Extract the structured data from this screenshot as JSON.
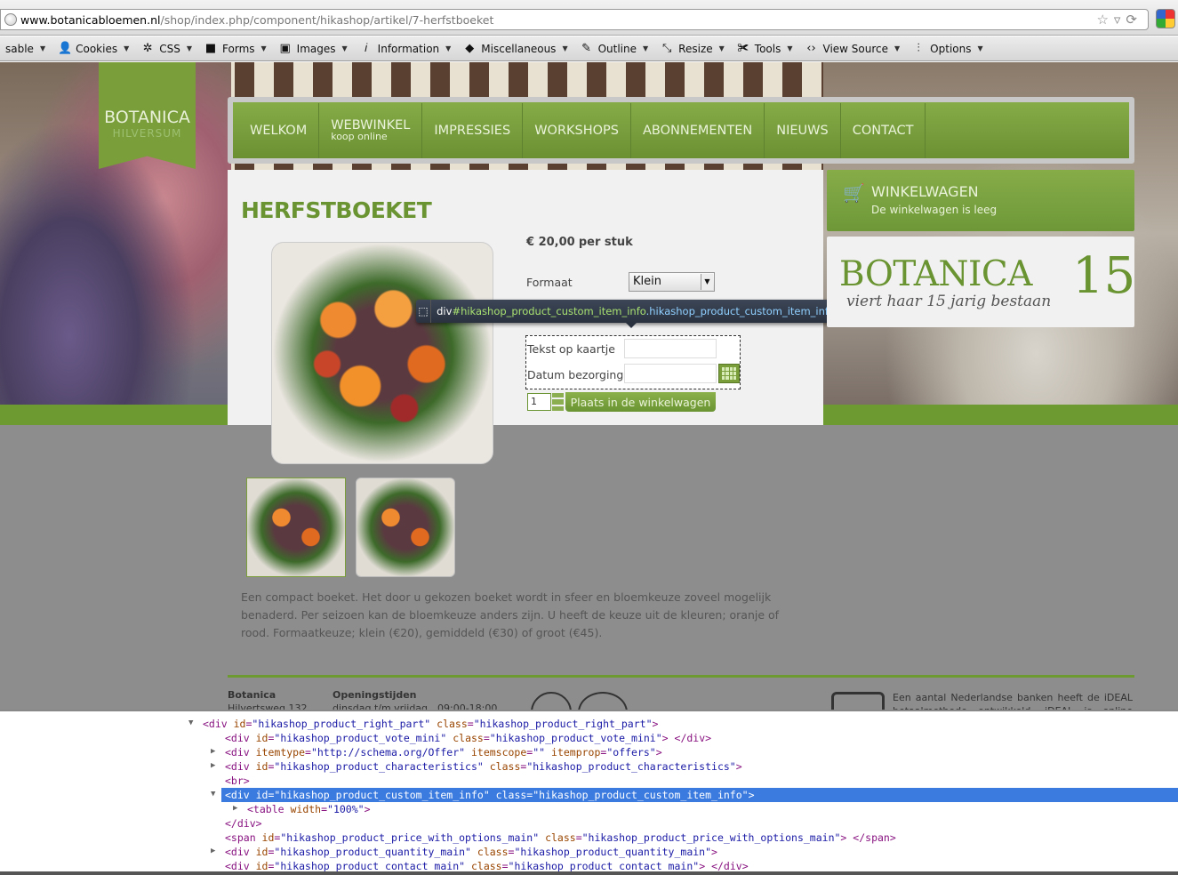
{
  "browser": {
    "url_host": "www.botanicabloemen.nl",
    "url_path": "/shop/index.php/component/hikashop/artikel/7-herfstboeket"
  },
  "toolbar": {
    "items": [
      {
        "label": "sable",
        "icon": "partial"
      },
      {
        "label": "Cookies",
        "icon": "user-icon"
      },
      {
        "label": "CSS",
        "icon": "wand-icon"
      },
      {
        "label": "Forms",
        "icon": "briefcase-icon"
      },
      {
        "label": "Images",
        "icon": "image-icon"
      },
      {
        "label": "Information",
        "icon": "info-icon"
      },
      {
        "label": "Miscellaneous",
        "icon": "cube-icon"
      },
      {
        "label": "Outline",
        "icon": "pencil-icon"
      },
      {
        "label": "Resize",
        "icon": "resize-icon"
      },
      {
        "label": "Tools",
        "icon": "wrench-icon"
      },
      {
        "label": "View Source",
        "icon": "code-icon"
      },
      {
        "label": "Options",
        "icon": "sliders-icon"
      }
    ]
  },
  "site": {
    "logo": {
      "name": "BOTANICA",
      "city": "HILVERSUM"
    },
    "nav": [
      {
        "label": "WELKOM",
        "sub": ""
      },
      {
        "label": "WEBWINKEL",
        "sub": "koop online"
      },
      {
        "label": "IMPRESSIES",
        "sub": ""
      },
      {
        "label": "WORKSHOPS",
        "sub": ""
      },
      {
        "label": "ABONNEMENTEN",
        "sub": ""
      },
      {
        "label": "NIEUWS",
        "sub": ""
      },
      {
        "label": "CONTACT",
        "sub": ""
      }
    ],
    "product": {
      "title": "HERFSTBOEKET",
      "price": "€ 20,00",
      "price_unit": "per stuk",
      "format_label": "Formaat",
      "format_value": "Klein",
      "card_text_label": "Tekst op kaartje",
      "delivery_date_label": "Datum bezorging",
      "quantity": "1",
      "cart_button": "Plaats in de winkelwagen",
      "description": "Een compact boeket. Het door u gekozen boeket wordt in sfeer en bloemkeuze zoveel mogelijk benaderd. Per seizoen kan de bloemkeuze anders zijn. U heeft de keuze uit de kleuren; oranje of rood. Formaatkeuze; klein (€20), gemiddeld (€30) of groot (€45)."
    },
    "cart": {
      "title": "WINKELWAGEN",
      "status": "De winkelwagen is leeg"
    },
    "promo": {
      "brand": "BOTANICA",
      "number": "15",
      "tagline": "viert haar 15 jarig bestaan"
    },
    "footer": {
      "name": "Botanica",
      "address": "Hilvertsweg 132",
      "hours_title": "Openingstijden",
      "days": "dinsdag t/m vrijdag",
      "time": "09:00-18:00",
      "ideal_text": "Een aantal Nederlandse banken heeft de iDEAL betaalmethode ontwikkeld. iDEAL is online betalen via"
    }
  },
  "inspector": {
    "tag": "div",
    "id": "#hikashop_product_custom_item_info",
    "cls": ".hikashop_product_custom_item_info"
  },
  "devtools": {
    "lines": [
      {
        "indent": 0,
        "tri": "down",
        "html": "<div id=\"hikashop_product_right_part\" class=\"hikashop_product_right_part\">"
      },
      {
        "indent": 1,
        "tri": "",
        "html": "<div id=\"hikashop_product_vote_mini\" class=\"hikashop_product_vote_mini\"> </div>"
      },
      {
        "indent": 1,
        "tri": "right",
        "html": "<div itemtype=\"http://schema.org/Offer\" itemscope=\"\" itemprop=\"offers\">"
      },
      {
        "indent": 1,
        "tri": "right",
        "html": "<div id=\"hikashop_product_characteristics\" class=\"hikashop_product_characteristics\">"
      },
      {
        "indent": 1,
        "tri": "",
        "html": "<br>"
      },
      {
        "indent": 1,
        "tri": "down",
        "html": "<div id=\"hikashop_product_custom_item_info\" class=\"hikashop_product_custom_item_info\">",
        "selected": true
      },
      {
        "indent": 2,
        "tri": "right",
        "html": "<table width=\"100%\">"
      },
      {
        "indent": 1,
        "tri": "",
        "html": "</div>"
      },
      {
        "indent": 1,
        "tri": "",
        "html": "<span id=\"hikashop_product_price_with_options_main\" class=\"hikashop_product_price_with_options_main\"> </span>"
      },
      {
        "indent": 1,
        "tri": "right",
        "html": "<div id=\"hikashop_product_quantity_main\" class=\"hikashop_product_quantity_main\">"
      },
      {
        "indent": 1,
        "tri": "",
        "html": "<div id=\"hikashop_product_contact_main\" class=\"hikashop_product_contact_main\"> </div>"
      }
    ]
  }
}
